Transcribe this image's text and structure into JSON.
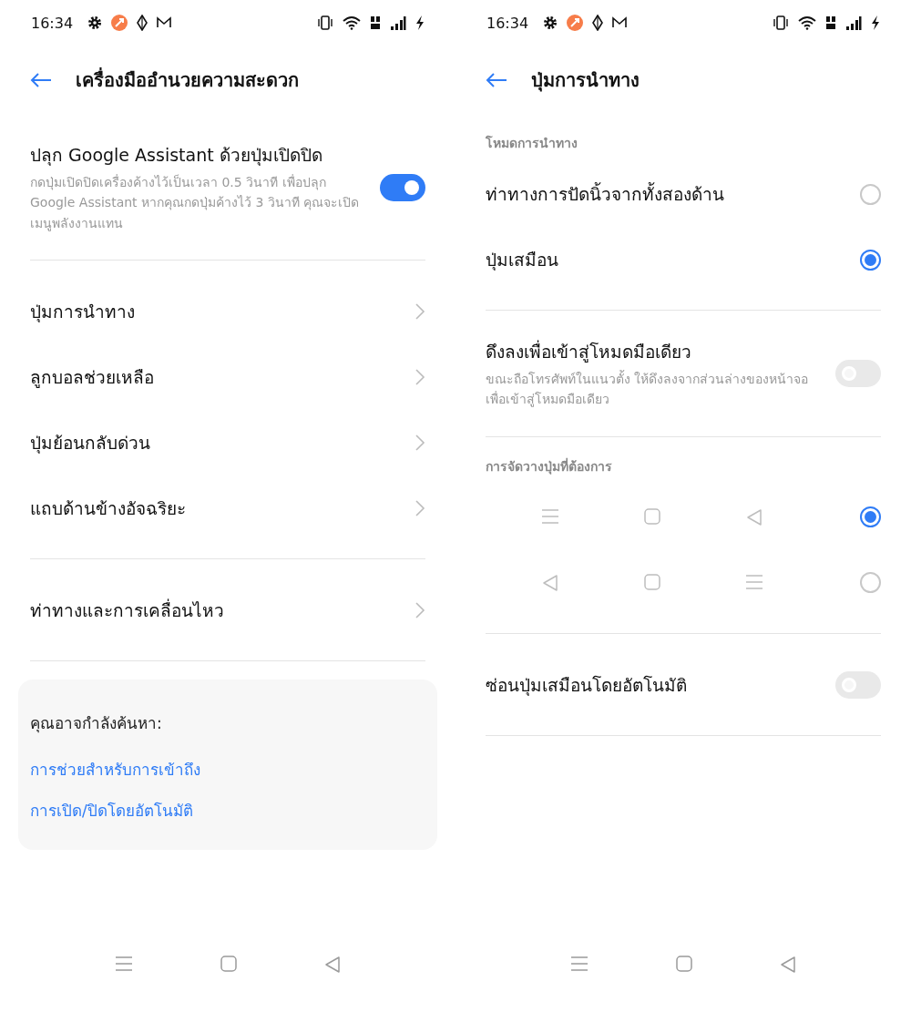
{
  "screens": [
    {
      "status_bar": {
        "time": "16:34"
      },
      "header": {
        "title": "เครื่องมืออำนวยความสะดวก"
      },
      "groups": [
        {
          "items": [
            {
              "kind": "toggle",
              "title": "ปลุก Google Assistant ด้วยปุ่มเปิดปิด",
              "description": "กดปุ่มเปิดปิดเครื่องค้างไว้เป็นเวลา 0.5 วินาที เพื่อปลุก Google Assistant หากคุณกดปุ่มค้างไว้ 3 วินาที คุณจะเปิดเมนูพลังงานแทน",
              "on": true
            }
          ]
        },
        {
          "items": [
            {
              "kind": "nav",
              "title": "ปุ่มการนำทาง"
            },
            {
              "kind": "nav",
              "title": "ลูกบอลช่วยเหลือ"
            },
            {
              "kind": "nav",
              "title": "ปุ่มย้อนกลับด่วน"
            },
            {
              "kind": "nav",
              "title": "แถบด้านข้างอัจฉริยะ"
            }
          ]
        },
        {
          "items": [
            {
              "kind": "nav",
              "title": "ท่าทางและการเคลื่อนไหว"
            }
          ]
        }
      ],
      "suggestions": {
        "title": "คุณอาจกำลังค้นหา:",
        "links": [
          "การช่วยสำหรับการเข้าถึง",
          "การเปิด/ปิดโดยอัตโนมัติ"
        ]
      }
    },
    {
      "status_bar": {
        "time": "16:34"
      },
      "header": {
        "title": "ปุ่มการนำทาง"
      },
      "groups": [
        {
          "heading": "โหมดการนำทาง",
          "items": [
            {
              "kind": "radio",
              "title": "ท่าทางการปัดนิ้วจากทั้งสองด้าน",
              "selected": false
            },
            {
              "kind": "radio",
              "title": "ปุ่มเสมือน",
              "selected": true
            }
          ]
        },
        {
          "items": [
            {
              "kind": "toggle",
              "title": "ดึงลงเพื่อเข้าสู่โหมดมือเดียว",
              "description": "ขณะถือโทรศัพท์ในแนวตั้ง ให้ดึงลงจากส่วนล่างของหน้าจอเพื่อเข้าสู่โหมดมือเดียว",
              "on": false
            }
          ]
        },
        {
          "heading": "การจัดวางปุ่มที่ต้องการ",
          "items": [
            {
              "kind": "layout",
              "icons": [
                {
                  "kind": "menu"
                },
                {
                  "kind": "home"
                },
                {
                  "kind": "back"
                }
              ],
              "selected": true
            },
            {
              "kind": "layout",
              "icons": [
                {
                  "kind": "back"
                },
                {
                  "kind": "home"
                },
                {
                  "kind": "menu"
                }
              ],
              "selected": false
            }
          ]
        },
        {
          "items": [
            {
              "kind": "toggle",
              "title": "ซ่อนปุ่มเสมือนโดยอัตโนมัติ",
              "on": false
            }
          ]
        }
      ]
    }
  ]
}
